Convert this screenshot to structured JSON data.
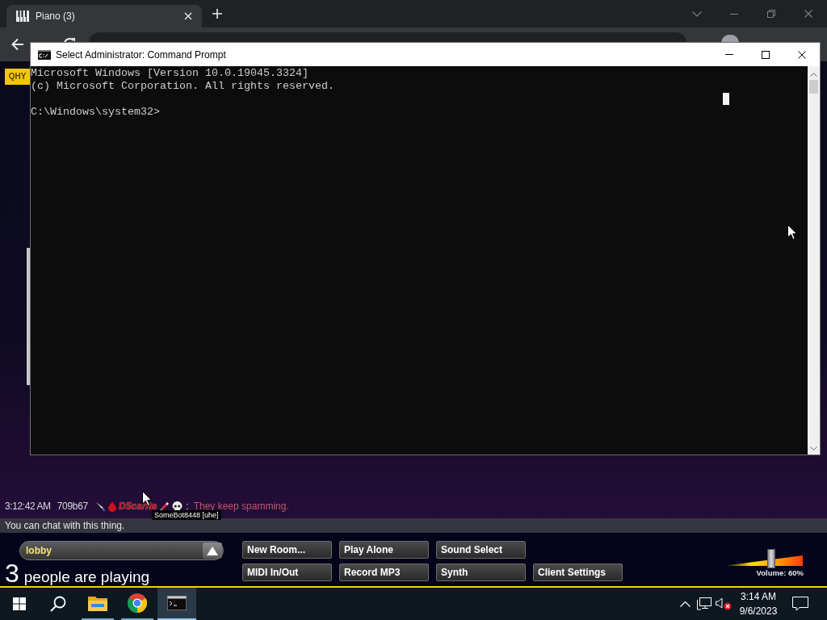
{
  "browser": {
    "tabs": [
      {
        "title": "Piano (3)",
        "selected": true
      }
    ]
  },
  "page": {
    "badge": "QHY",
    "chat": {
      "messages": [
        {
          "time": "3:12:42 AM",
          "user_id": "709b67",
          "name": "D5carite",
          "separator": ":",
          "text": "They keep spamming."
        }
      ],
      "tooltip": "SomeBot8448 [uhe]",
      "input": {
        "placeholder": "You can chat with this thing."
      }
    },
    "room_select": {
      "value": "lobby"
    },
    "player_count": {
      "count": "3",
      "label": "people are playing"
    },
    "button_rows": [
      [
        {
          "label": "New Room..."
        },
        {
          "label": "Play Alone"
        },
        {
          "label": "Sound Select"
        }
      ],
      [
        {
          "label": "MIDI In/Out"
        },
        {
          "label": "Record MP3"
        },
        {
          "label": "Synth"
        },
        {
          "label": "Client Settings"
        }
      ]
    ],
    "volume": {
      "level": 0.6,
      "label": "Volume: 60%"
    }
  },
  "cmd_window": {
    "title": "Select Administrator: Command Prompt",
    "output": [
      "Microsoft Windows [Version 10.0.19045.3324]",
      "(c) Microsoft Corporation. All rights reserved."
    ],
    "prompt": "C:\\Windows\\system32>"
  },
  "taskbar": {
    "apps": [
      {
        "kind": "explorer",
        "running": true,
        "selected": false
      },
      {
        "kind": "chrome",
        "running": true,
        "selected": false
      },
      {
        "kind": "terminal",
        "running": true,
        "selected": true
      }
    ],
    "clock": {
      "time": "3:14 AM",
      "date": "9/6/2023"
    }
  }
}
